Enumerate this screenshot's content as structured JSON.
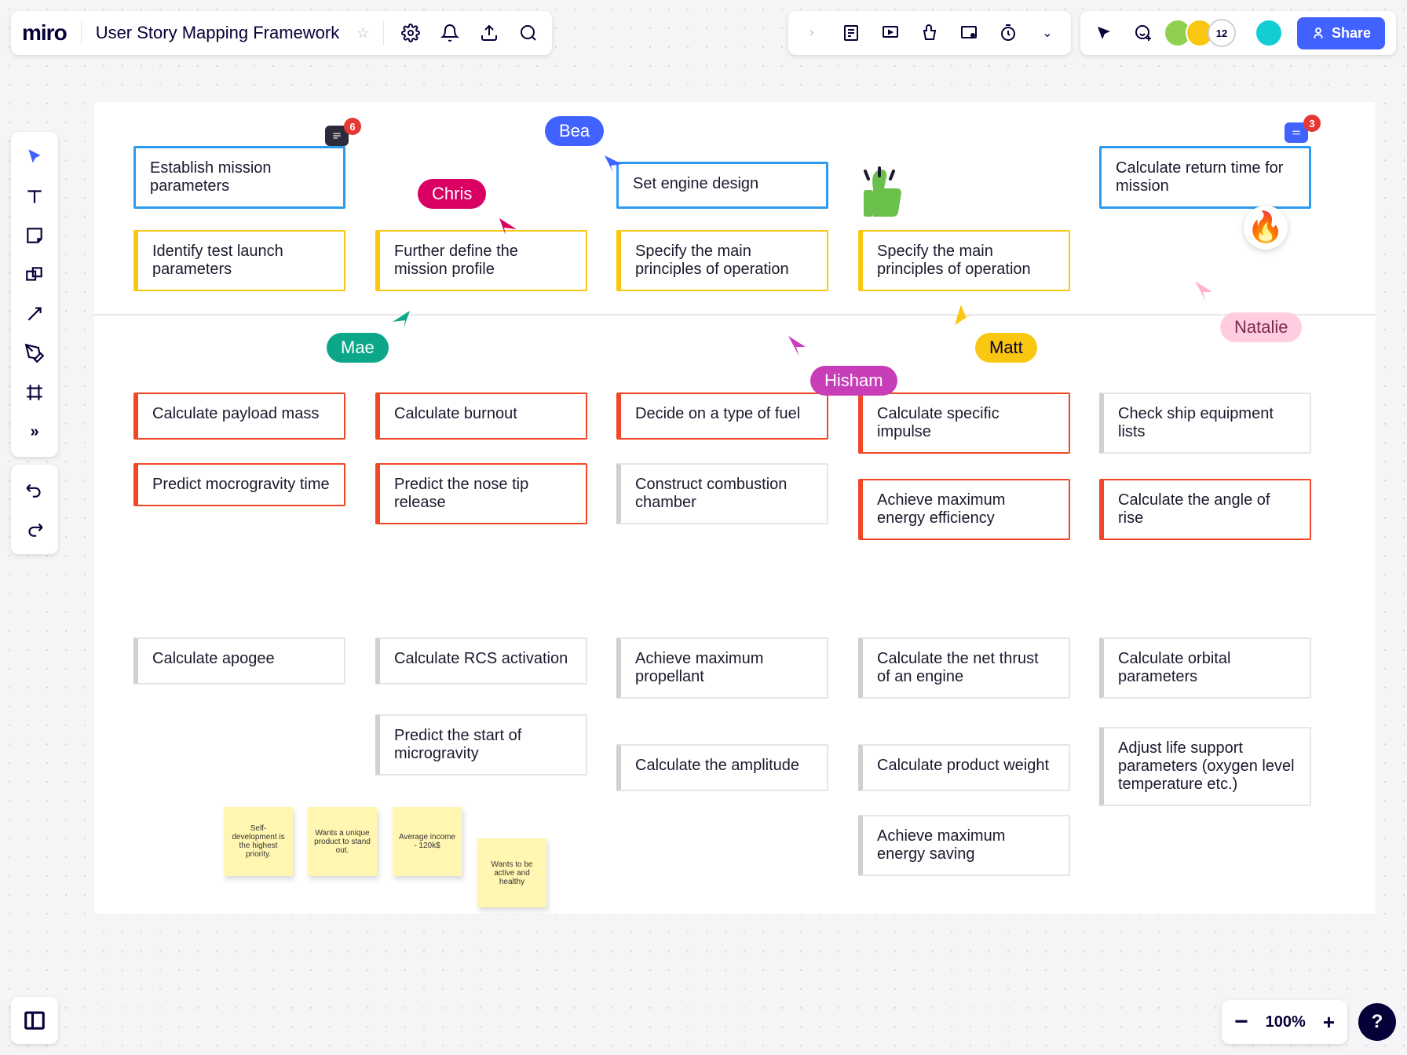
{
  "app": {
    "logo": "miro",
    "board_title": "User Story Mapping Framework"
  },
  "share": {
    "label": "Share"
  },
  "avatars": {
    "extra_count": "12"
  },
  "zoom": {
    "level": "100%"
  },
  "comments": {
    "c1_count": "6",
    "c2_count": "3"
  },
  "cursors": {
    "bea": "Bea",
    "chris": "Chris",
    "mae": "Mae",
    "hisham": "Hisham",
    "matt": "Matt",
    "natalie": "Natalie"
  },
  "cards": {
    "blue1": "Establish mission parameters",
    "blue2": "Set engine design",
    "blue3": "Calculate return time for mission",
    "y1": "Identify test launch parameters",
    "y2": "Further define the mission profile",
    "y3": "Specify the main principles of operation",
    "y4": "Specify the main principles of operation",
    "r1": "Calculate payload mass",
    "r2": "Calculate burnout",
    "r3": "Decide on a type of fuel",
    "r4": "Calculate specific impulse",
    "r5": "Predict mocrogravity time",
    "r6": "Predict the nose tip release",
    "r7": "Achieve maximum energy efficiency",
    "r8": "Calculate the angle of rise",
    "g1": "Construct combustion chamber",
    "g2": "Check ship equipment lists",
    "g3": "Calculate apogee",
    "g4": "Calculate RCS activation",
    "g5": "Achieve maximum propellant",
    "g6": "Calculate the net thrust of an engine",
    "g7": "Calculate orbital parameters",
    "g8": "Predict the start of microgravity",
    "g9": "Calculate the amplitude",
    "g10": "Calculate product weight",
    "g11": "Adjust life support parameters (oxygen level temperature etc.)",
    "g12": "Achieve maximum energy saving"
  },
  "stickies": {
    "s1": "Self-development is the highest priority.",
    "s2": "Wants a unique product to stand out.",
    "s3": "Average income - 120k$",
    "s4": "Wants to be active and healthy"
  }
}
